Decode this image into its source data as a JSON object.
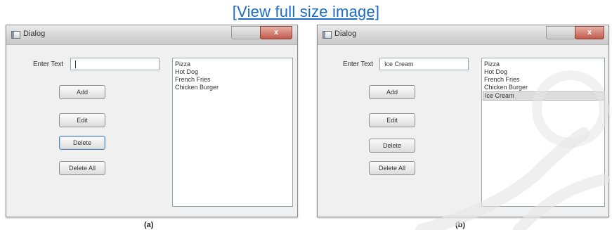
{
  "link_text": "[View full size image]",
  "panels": [
    {
      "caption": "(a)",
      "title": "Dialog",
      "close_glyph": "x",
      "label": "Enter Text",
      "input_value": "",
      "buttons": [
        "Add",
        "Edit",
        "Delete",
        "Delete All"
      ],
      "list_items": [
        "Pizza",
        "Hot Dog",
        "French Fries",
        "Chicken Burger"
      ],
      "selected_index": -1
    },
    {
      "caption": "(b)",
      "title": "Dialog",
      "close_glyph": "x",
      "label": "Enter Text",
      "input_value": "Ice Cream",
      "buttons": [
        "Add",
        "Edit",
        "Delete",
        "Delete All"
      ],
      "list_items": [
        "Pizza",
        "Hot Dog",
        "French Fries",
        "Chicken Burger",
        "Ice Cream"
      ],
      "selected_index": 4
    }
  ],
  "colors": {
    "link": "#1a6cc4",
    "window_bg": "#f0f0f0",
    "close_button": "#c0584a"
  },
  "icons": [
    "window-app-icon",
    "close-icon"
  ]
}
